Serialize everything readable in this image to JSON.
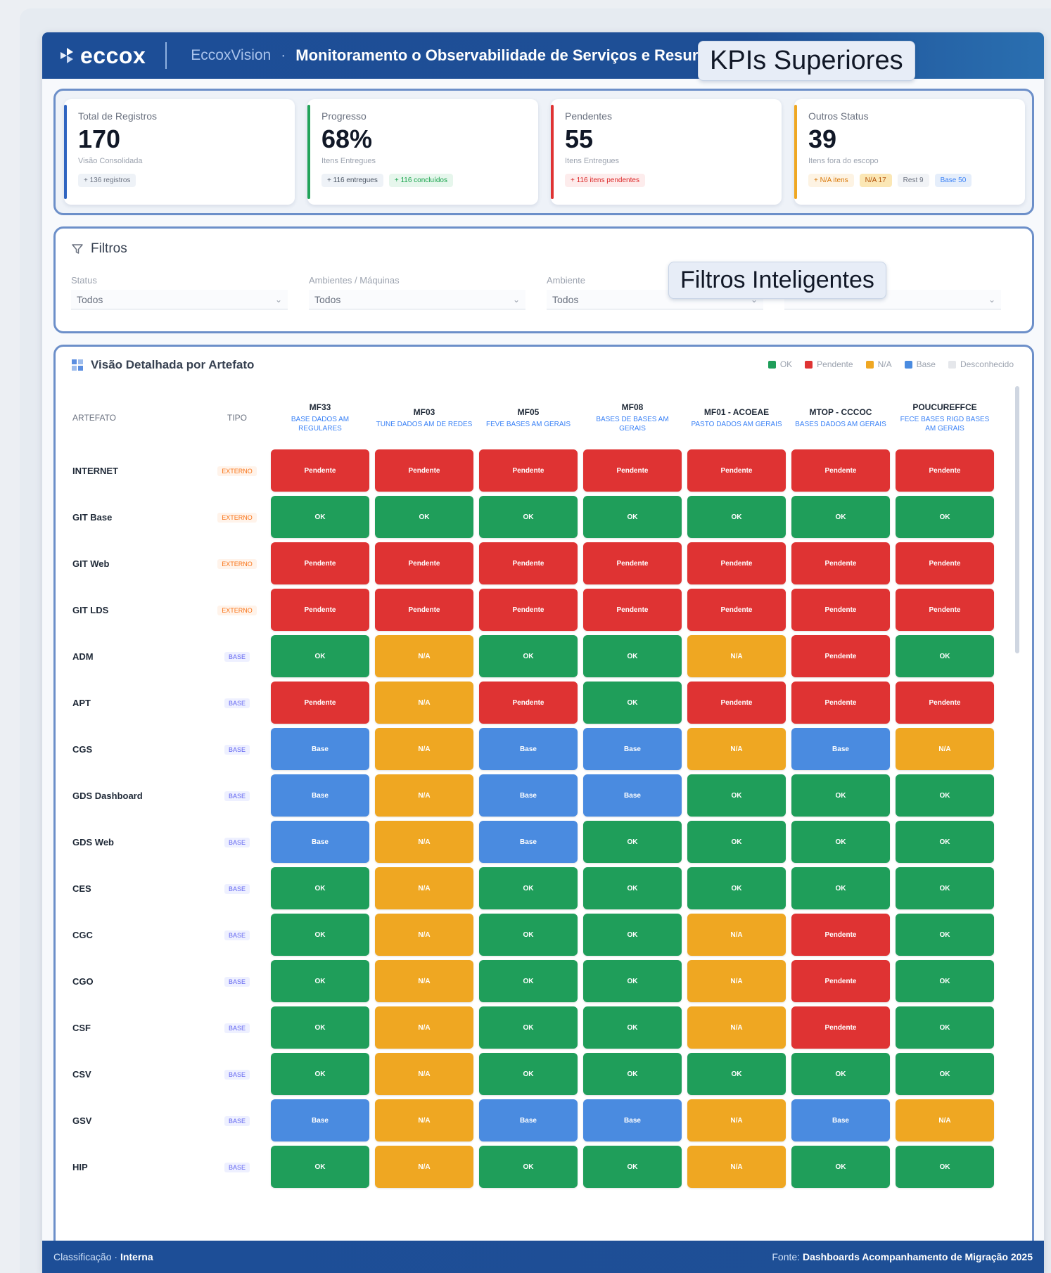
{
  "header": {
    "brand": "eccox",
    "product": "EccoxVision",
    "title": "Monitoramento o Observabilidade de Serviços e Resursos Maioh"
  },
  "callouts": {
    "kpis": "KPIs Superiores",
    "filters": "Filtros Inteligentes"
  },
  "kpis": [
    {
      "label": "Total de Registros",
      "value": "170",
      "sub": "Visão Consolidada",
      "bar_color": "#2f64c0",
      "chips": [
        {
          "text": "+ 136 registros"
        }
      ]
    },
    {
      "label": "Progresso",
      "value": "68%",
      "sub": "Itens Entregues",
      "bar_color": "#22a35a",
      "chips": [
        {
          "text": "+ 116 entregues"
        },
        {
          "text": "+ 116 concluídos"
        }
      ]
    },
    {
      "label": "Pendentes",
      "value": "55",
      "sub": "Itens Entregues",
      "bar_color": "#df3333",
      "chips": [
        {
          "text": "+ 116 itens pendentes"
        }
      ]
    },
    {
      "label": "Outros Status",
      "value": "39",
      "sub": "Itens fora do escopo",
      "bar_color": "#efa722",
      "chips": [
        {
          "text": "+ N/A itens"
        },
        {
          "text": "N/A 17"
        },
        {
          "text": "Rest 9"
        },
        {
          "text": "Base 50"
        }
      ]
    }
  ],
  "filters": {
    "title": "Filtros",
    "fields": [
      {
        "label": "Status",
        "value": "Todos"
      },
      {
        "label": "Ambientes / Máquinas",
        "value": "Todos"
      },
      {
        "label": "Ambiente",
        "value": "Todos"
      },
      {
        "label": "Tipo de Produto",
        "value": ""
      }
    ]
  },
  "matrix": {
    "title": "Visão Detalhada por Artefato",
    "legend": [
      {
        "label": "OK",
        "color": "#1f9e5a"
      },
      {
        "label": "Pendente",
        "color": "#df3333"
      },
      {
        "label": "N/A",
        "color": "#efa722"
      },
      {
        "label": "Base",
        "color": "#4a8be0"
      },
      {
        "label": "Desconhecido",
        "color": "#e5e7eb"
      }
    ],
    "col_artifact": "ARTEFATO",
    "col_type": "TIPO",
    "columns": [
      {
        "name": "MF33",
        "sub": "BASE DADOS AM REGULARES"
      },
      {
        "name": "MF03",
        "sub": "TUNE DADOS AM DE REDES"
      },
      {
        "name": "MF05",
        "sub": "FEVE BASES AM GERAIS"
      },
      {
        "name": "MF08",
        "sub": "BASES DE BASES AM GERAIS"
      },
      {
        "name": "MF01 - ACOEAE",
        "sub": "PASTO DADOS AM GERAIS"
      },
      {
        "name": "MTOP - CCCOC",
        "sub": "BASES DADOS AM GERAIS"
      },
      {
        "name": "POUCUREFFCE",
        "sub": "FECE BASES RIGD BASES AM GERAIS"
      }
    ],
    "rows": [
      {
        "name": "INTERNET",
        "type": "EXTERNO",
        "type_class": "ext",
        "cells": [
          "red",
          "red",
          "red",
          "red",
          "red",
          "red",
          "red"
        ],
        "labels": [
          "Pendente",
          "Pendente",
          "Pendente",
          "Pendente",
          "Pendente",
          "Pendente",
          "Pendente"
        ]
      },
      {
        "name": "GIT Base",
        "type": "EXTERNO",
        "type_class": "ext",
        "cells": [
          "green",
          "green",
          "green",
          "green",
          "green",
          "green",
          "green"
        ],
        "labels": [
          "OK",
          "OK",
          "OK",
          "OK",
          "OK",
          "OK",
          "OK"
        ]
      },
      {
        "name": "GIT Web",
        "type": "EXTERNO",
        "type_class": "ext",
        "cells": [
          "red",
          "red",
          "red",
          "red",
          "red",
          "red",
          "red"
        ],
        "labels": [
          "Pendente",
          "Pendente",
          "Pendente",
          "Pendente",
          "Pendente",
          "Pendente",
          "Pendente"
        ]
      },
      {
        "name": "GIT LDS",
        "type": "EXTERNO",
        "type_class": "ext",
        "cells": [
          "red",
          "red",
          "red",
          "red",
          "red",
          "red",
          "red"
        ],
        "labels": [
          "Pendente",
          "Pendente",
          "Pendente",
          "Pendente",
          "Pendente",
          "Pendente",
          "Pendente"
        ]
      },
      {
        "name": "ADM",
        "type": "BASE",
        "type_class": "int",
        "cells": [
          "green",
          "orange",
          "green",
          "green",
          "orange",
          "red",
          "green"
        ],
        "labels": [
          "OK",
          "N/A",
          "OK",
          "OK",
          "N/A",
          "Pendente",
          "OK"
        ]
      },
      {
        "name": "APT",
        "type": "BASE",
        "type_class": "int",
        "cells": [
          "red",
          "orange",
          "red",
          "green",
          "red",
          "red",
          "red"
        ],
        "labels": [
          "Pendente",
          "N/A",
          "Pendente",
          "OK",
          "Pendente",
          "Pendente",
          "Pendente"
        ]
      },
      {
        "name": "CGS",
        "type": "BASE",
        "type_class": "int",
        "cells": [
          "blue",
          "orange",
          "blue",
          "blue",
          "orange",
          "blue",
          "orange"
        ],
        "labels": [
          "Base",
          "N/A",
          "Base",
          "Base",
          "N/A",
          "Base",
          "N/A"
        ]
      },
      {
        "name": "GDS Dashboard",
        "type": "BASE",
        "type_class": "int",
        "cells": [
          "blue",
          "orange",
          "blue",
          "blue",
          "green",
          "green",
          "green"
        ],
        "labels": [
          "Base",
          "N/A",
          "Base",
          "Base",
          "OK",
          "OK",
          "OK"
        ]
      },
      {
        "name": "GDS Web",
        "type": "BASE",
        "type_class": "int",
        "cells": [
          "blue",
          "orange",
          "blue",
          "green",
          "green",
          "green",
          "green"
        ],
        "labels": [
          "Base",
          "N/A",
          "Base",
          "OK",
          "OK",
          "OK",
          "OK"
        ]
      },
      {
        "name": "CES",
        "type": "BASE",
        "type_class": "int",
        "cells": [
          "green",
          "orange",
          "green",
          "green",
          "green",
          "green",
          "green"
        ],
        "labels": [
          "OK",
          "N/A",
          "OK",
          "OK",
          "OK",
          "OK",
          "OK"
        ]
      },
      {
        "name": "CGC",
        "type": "BASE",
        "type_class": "int",
        "cells": [
          "green",
          "orange",
          "green",
          "green",
          "orange",
          "red",
          "green"
        ],
        "labels": [
          "OK",
          "N/A",
          "OK",
          "OK",
          "N/A",
          "Pendente",
          "OK"
        ]
      },
      {
        "name": "CGO",
        "type": "BASE",
        "type_class": "int",
        "cells": [
          "green",
          "orange",
          "green",
          "green",
          "orange",
          "red",
          "green"
        ],
        "labels": [
          "OK",
          "N/A",
          "OK",
          "OK",
          "N/A",
          "Pendente",
          "OK"
        ]
      },
      {
        "name": "CSF",
        "type": "BASE",
        "type_class": "int",
        "cells": [
          "green",
          "orange",
          "green",
          "green",
          "orange",
          "red",
          "green"
        ],
        "labels": [
          "OK",
          "N/A",
          "OK",
          "OK",
          "N/A",
          "Pendente",
          "OK"
        ]
      },
      {
        "name": "CSV",
        "type": "BASE",
        "type_class": "int",
        "cells": [
          "green",
          "orange",
          "green",
          "green",
          "green",
          "green",
          "green"
        ],
        "labels": [
          "OK",
          "N/A",
          "OK",
          "OK",
          "OK",
          "OK",
          "OK"
        ]
      },
      {
        "name": "GSV",
        "type": "BASE",
        "type_class": "int",
        "cells": [
          "blue",
          "orange",
          "blue",
          "blue",
          "orange",
          "blue",
          "orange"
        ],
        "labels": [
          "Base",
          "N/A",
          "Base",
          "Base",
          "N/A",
          "Base",
          "N/A"
        ]
      },
      {
        "name": "HIP",
        "type": "BASE",
        "type_class": "int",
        "cells": [
          "green",
          "orange",
          "green",
          "green",
          "orange",
          "green",
          "green"
        ],
        "labels": [
          "OK",
          "N/A",
          "OK",
          "OK",
          "N/A",
          "OK",
          "OK"
        ]
      }
    ]
  },
  "footer": {
    "left": "Classificação",
    "left_strong": "Interna",
    "right": "Fonte:",
    "right_strong": "Dashboards Acompanhamento de Migração 2025"
  }
}
